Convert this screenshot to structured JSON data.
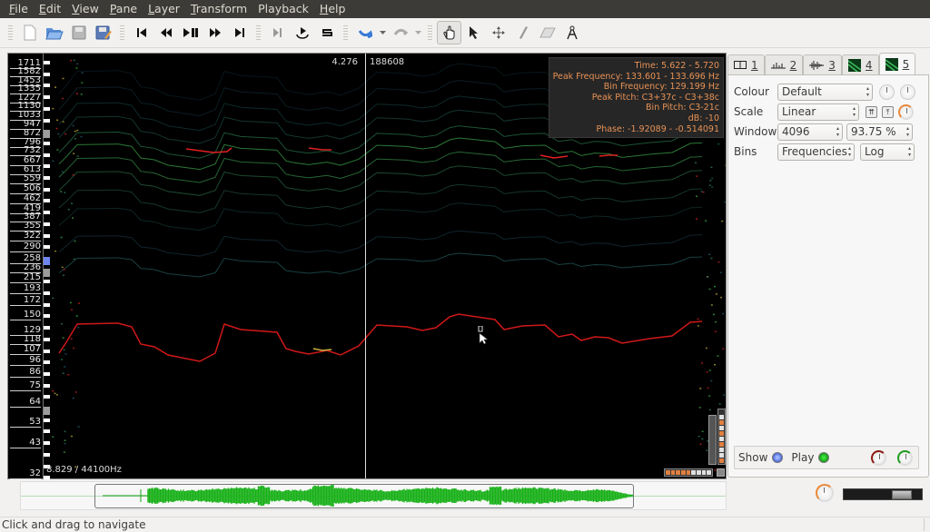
{
  "menubar": {
    "items": [
      {
        "label": "File",
        "mnemonic": "F",
        "rest": "ile"
      },
      {
        "label": "Edit",
        "mnemonic": "E",
        "rest": "dit"
      },
      {
        "label": "View",
        "mnemonic": "V",
        "rest": "iew"
      },
      {
        "label": "Pane",
        "mnemonic": "P",
        "rest": "ane"
      },
      {
        "label": "Layer",
        "mnemonic": "L",
        "rest": "ayer"
      },
      {
        "label": "Transform",
        "mnemonic": "T",
        "rest": "ransform"
      },
      {
        "label": "Playback",
        "mnemonic": "",
        "rest": "Playback"
      },
      {
        "label": "Help",
        "mnemonic": "H",
        "rest": "elp"
      }
    ]
  },
  "toolbar": {
    "file_tools": [
      "new-document-icon",
      "open-file-icon",
      "save-icon",
      "save-as-icon"
    ],
    "transport_tools": [
      "rewind-start-icon",
      "rewind-icon",
      "play-pause-icon",
      "fast-forward-icon",
      "fast-forward-end-icon"
    ],
    "playback_tools": [
      "play-selection-icon",
      "loop-icon",
      "solo-icon"
    ],
    "edit_tools": [
      "undo-icon",
      "redo-icon"
    ],
    "mode_tools": [
      {
        "icon": "navigate-hand-icon",
        "active": true
      },
      {
        "icon": "select-arrow-icon",
        "active": false
      },
      {
        "icon": "move-icon",
        "active": false
      },
      {
        "icon": "draw-pencil-icon",
        "active": false
      },
      {
        "icon": "erase-icon",
        "active": false
      },
      {
        "icon": "measure-compass-icon",
        "active": false
      }
    ]
  },
  "pane": {
    "frequency_scale": [
      "1711",
      "1582",
      "1453",
      "1335",
      "1227",
      "1130",
      "1033",
      "947",
      "872",
      "796",
      "732",
      "667",
      "613",
      "559",
      "506",
      "462",
      "419",
      "387",
      "355",
      "322",
      "290",
      "258",
      "236",
      "215",
      "193",
      "172",
      "150",
      "129",
      "118",
      "107",
      "96",
      "86",
      "75",
      "64",
      "53",
      "43",
      "32"
    ],
    "cursor_time": "4.276",
    "cursor_frame": "188608",
    "sample_rate_label": "8.829 / 44100Hz",
    "info": {
      "time": "Time: 5.622 - 5.720",
      "peak_frequency": "Peak Frequency: 133.601 - 133.696 Hz",
      "bin_frequency": "Bin Frequency: 129.199 Hz",
      "peak_pitch": "Peak Pitch: C3+37c - C3+38c",
      "bin_pitch": "Bin Pitch: C3-21c",
      "db": "dB: -10",
      "phase": "Phase: -1.92089 - -0.514091"
    },
    "colors": {
      "background": "#000000",
      "fundamental": "#d01818",
      "harmonic": "#3fa860",
      "info_text": "#e89256"
    }
  },
  "right_panel": {
    "tabs": [
      {
        "num": "1",
        "icon": "ruler-layer-icon",
        "active": false
      },
      {
        "num": "2",
        "icon": "time-instants-layer-icon",
        "active": false
      },
      {
        "num": "3",
        "icon": "waveform-layer-icon",
        "active": false
      },
      {
        "num": "4",
        "icon": "spectrogram-layer-icon",
        "active": false
      },
      {
        "num": "5",
        "icon": "spectrogram-layer-icon",
        "active": true
      }
    ],
    "props": {
      "colour_label": "Colour",
      "colour_value": "Default",
      "scale_label": "Scale",
      "scale_value": "Linear",
      "window_label": "Window",
      "window_value": "4096",
      "overlap_value": "93.75 %",
      "bins_label": "Bins",
      "bins_value": "Frequencies",
      "bins_scale_value": "Log"
    },
    "show_label": "Show",
    "play_label": "Play"
  },
  "status": {
    "text": "Click and drag to navigate"
  }
}
